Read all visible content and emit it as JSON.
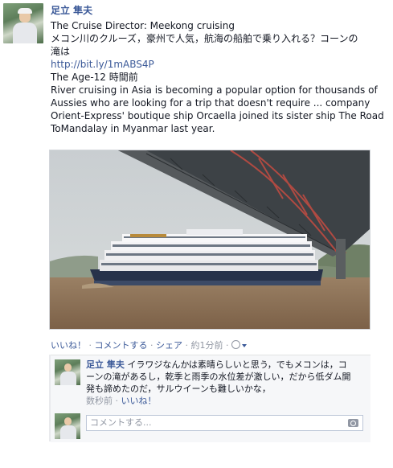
{
  "post": {
    "author": "足立 隼夫",
    "shared_title": "The Cruise Director: Meekong cruising",
    "message_line1": "メコン川のクルーズ，豪州で人気，航海の船舶で乗り入れる？コーンの",
    "message_line2": "滝は",
    "link": "http://bit.ly/1mABS4P",
    "source_time": "The Age-12 時間前",
    "excerpt_line1": "River cruising in Asia is becoming a popular option for thousands of",
    "excerpt_line2": "Aussies who are looking for a trip that doesn't require ... company",
    "excerpt_line3": "Orient-Express' boutique ship Orcaella joined its sister ship The Road",
    "excerpt_line4": "ToMandalay in Myanmar last year."
  },
  "actions": {
    "like": "いいね！",
    "sep": "·",
    "comment": "コメントする",
    "share": "シェア",
    "time": "約1分前",
    "privacy_icon": "globe-icon"
  },
  "comment": {
    "author": "足立 隼夫",
    "text_part1": " イラワジなんかは素晴らしいと思う，でもメコンは，コ",
    "text_line2": "ーンの滝があるし，乾季と雨季の水位差が激しい，だから低ダム開",
    "text_line3": "発も諦めたのだ，サルウイーンも難しいかな，",
    "time": "数秒前",
    "like": "いいね！"
  },
  "comment_input": {
    "placeholder": "コメントする..."
  }
}
